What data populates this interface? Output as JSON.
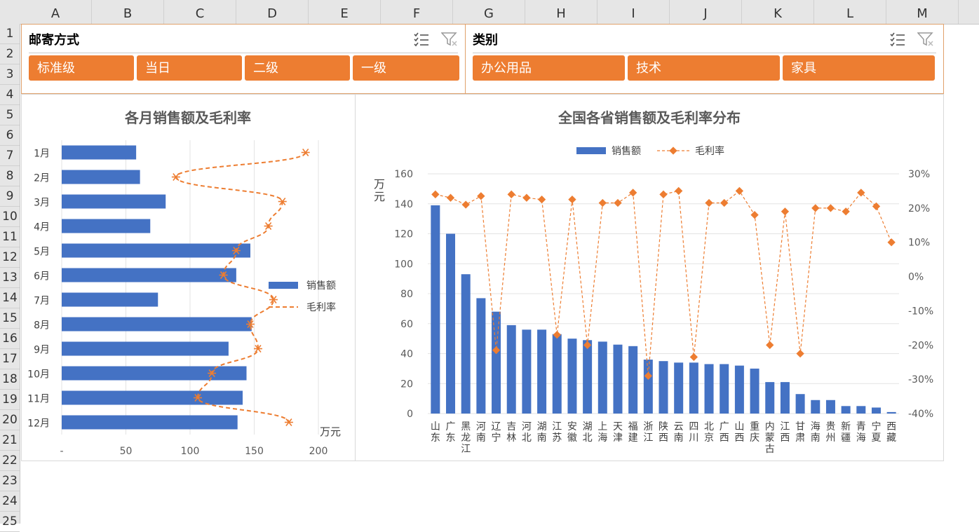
{
  "sheet": {
    "columns": [
      "A",
      "B",
      "C",
      "D",
      "E",
      "F",
      "G",
      "H",
      "I",
      "J",
      "K",
      "L",
      "M"
    ],
    "rows": [
      "1",
      "2",
      "3",
      "4",
      "5",
      "6",
      "7",
      "8",
      "9",
      "10",
      "11",
      "12",
      "13",
      "14",
      "15",
      "16",
      "17",
      "18",
      "19",
      "20",
      "21",
      "22",
      "23",
      "24",
      "25"
    ]
  },
  "slicers": {
    "shipping": {
      "title": "邮寄方式",
      "buttons": [
        "标准级",
        "当日",
        "二级",
        "一级"
      ],
      "icons": [
        "multi-select-icon",
        "clear-filter-icon"
      ]
    },
    "category": {
      "title": "类别",
      "buttons": [
        "办公用品",
        "技术",
        "家具"
      ],
      "icons": [
        "multi-select-icon",
        "clear-filter-icon"
      ]
    }
  },
  "colors": {
    "bar": "#4472c4",
    "line": "#ed7d31",
    "slicer_button": "#ed7d31"
  },
  "chart_data": [
    {
      "type": "bar",
      "orientation": "horizontal",
      "title": "各月销售额及毛利率",
      "unit_label": "万元",
      "categories": [
        "1月",
        "2月",
        "3月",
        "4月",
        "5月",
        "6月",
        "7月",
        "8月",
        "9月",
        "10月",
        "11月",
        "12月"
      ],
      "x_ticks": [
        "-",
        "50",
        "100",
        "150",
        "200"
      ],
      "xlim": [
        0,
        200
      ],
      "series": [
        {
          "name": "销售额",
          "type": "bar",
          "values": [
            58,
            61,
            81,
            69,
            147,
            136,
            75,
            148,
            130,
            144,
            141,
            137
          ]
        },
        {
          "name": "毛利率",
          "type": "line",
          "marker": "star",
          "values": [
            190,
            89,
            172,
            161,
            136,
            126,
            165,
            147,
            153,
            117,
            106,
            177
          ]
        }
      ],
      "legend": "right"
    },
    {
      "type": "bar",
      "title": "全国各省销售额及毛利率分布",
      "ylabel": "万元",
      "categories": [
        "山东",
        "广东",
        "黑龙江",
        "河南",
        "辽宁",
        "吉林",
        "河北",
        "湖南",
        "江苏",
        "安徽",
        "湖北",
        "上海",
        "天津",
        "福建",
        "浙江",
        "陕西",
        "云南",
        "四川",
        "北京",
        "广西",
        "山西",
        "重庆",
        "内蒙古",
        "江西",
        "甘肃",
        "海南",
        "贵州",
        "新疆",
        "青海",
        "宁夏",
        "西藏"
      ],
      "ylim": [
        0,
        160
      ],
      "y_ticks": [
        "0",
        "20",
        "40",
        "60",
        "80",
        "100",
        "120",
        "140",
        "160"
      ],
      "y2lim": [
        -0.4,
        0.3
      ],
      "y2_ticks": [
        "-40%",
        "-30%",
        "-20%",
        "-10%",
        "0%",
        "10%",
        "20%",
        "30%"
      ],
      "series": [
        {
          "name": "销售额",
          "type": "bar",
          "values": [
            139,
            120,
            93,
            77,
            68,
            59,
            56,
            56,
            53,
            50,
            49,
            48,
            46,
            45,
            36,
            35,
            34,
            34,
            33,
            33,
            32,
            30,
            21,
            21,
            13,
            9,
            9,
            5,
            5,
            4,
            1
          ]
        },
        {
          "name": "毛利率",
          "type": "line",
          "axis": "secondary",
          "values": [
            0.24,
            0.23,
            0.21,
            0.235,
            -0.215,
            0.24,
            0.23,
            0.225,
            -0.17,
            0.225,
            -0.2,
            0.215,
            0.215,
            0.245,
            -0.29,
            0.24,
            0.25,
            -0.235,
            0.215,
            0.215,
            0.25,
            0.18,
            -0.2,
            0.19,
            -0.225,
            0.2,
            0.2,
            0.19,
            0.245,
            0.205,
            0.1
          ]
        }
      ],
      "legend": "top"
    }
  ]
}
